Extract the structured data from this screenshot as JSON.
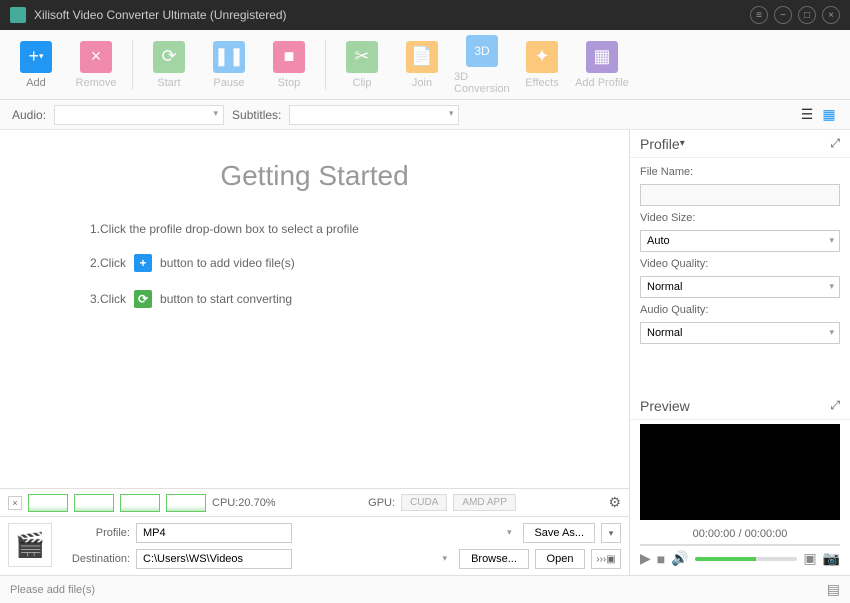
{
  "titlebar": {
    "title": "Xilisoft Video Converter Ultimate (Unregistered)"
  },
  "toolbar": {
    "add": "Add",
    "remove": "Remove",
    "start": "Start",
    "pause": "Pause",
    "stop": "Stop",
    "clip": "Clip",
    "join": "Join",
    "conv3d": "3D Conversion",
    "effects": "Effects",
    "addprofile": "Add Profile"
  },
  "subbar": {
    "audio_label": "Audio:",
    "subtitles_label": "Subtitles:",
    "audio_value": "",
    "subtitles_value": ""
  },
  "getting_started": {
    "title": "Getting Started",
    "step1": "1.Click the profile drop-down box to select a profile",
    "step2_a": "2.Click",
    "step2_b": "button to add video file(s)",
    "step3_a": "3.Click",
    "step3_b": "button to start converting"
  },
  "cpu": {
    "label": "CPU:20.70%",
    "gpu_label": "GPU:",
    "cuda": "CUDA",
    "amd": "AMD APP"
  },
  "bottom": {
    "profile_label": "Profile:",
    "profile_value": "MP4",
    "dest_label": "Destination:",
    "dest_value": "C:\\Users\\WS\\Videos",
    "saveas": "Save As...",
    "browse": "Browse...",
    "open": "Open"
  },
  "profile_panel": {
    "header": "Profile",
    "filename_label": "File Name:",
    "filename_value": "",
    "videosize_label": "Video Size:",
    "videosize_value": "Auto",
    "videoquality_label": "Video Quality:",
    "videoquality_value": "Normal",
    "audioquality_label": "Audio Quality:",
    "audioquality_value": "Normal"
  },
  "preview": {
    "header": "Preview",
    "time": "00:00:00 / 00:00:00"
  },
  "statusbar": {
    "msg": "Please add file(s)"
  },
  "colors": {
    "add": "#2196f3",
    "remove": "#e91e63",
    "start": "#4caf50",
    "pause": "#2196f3",
    "stop": "#e91e63",
    "clip": "#4caf50",
    "join": "#ff9800",
    "conv3d": "#2196f3",
    "effects": "#ff9800",
    "addprofile": "#673ab7"
  }
}
